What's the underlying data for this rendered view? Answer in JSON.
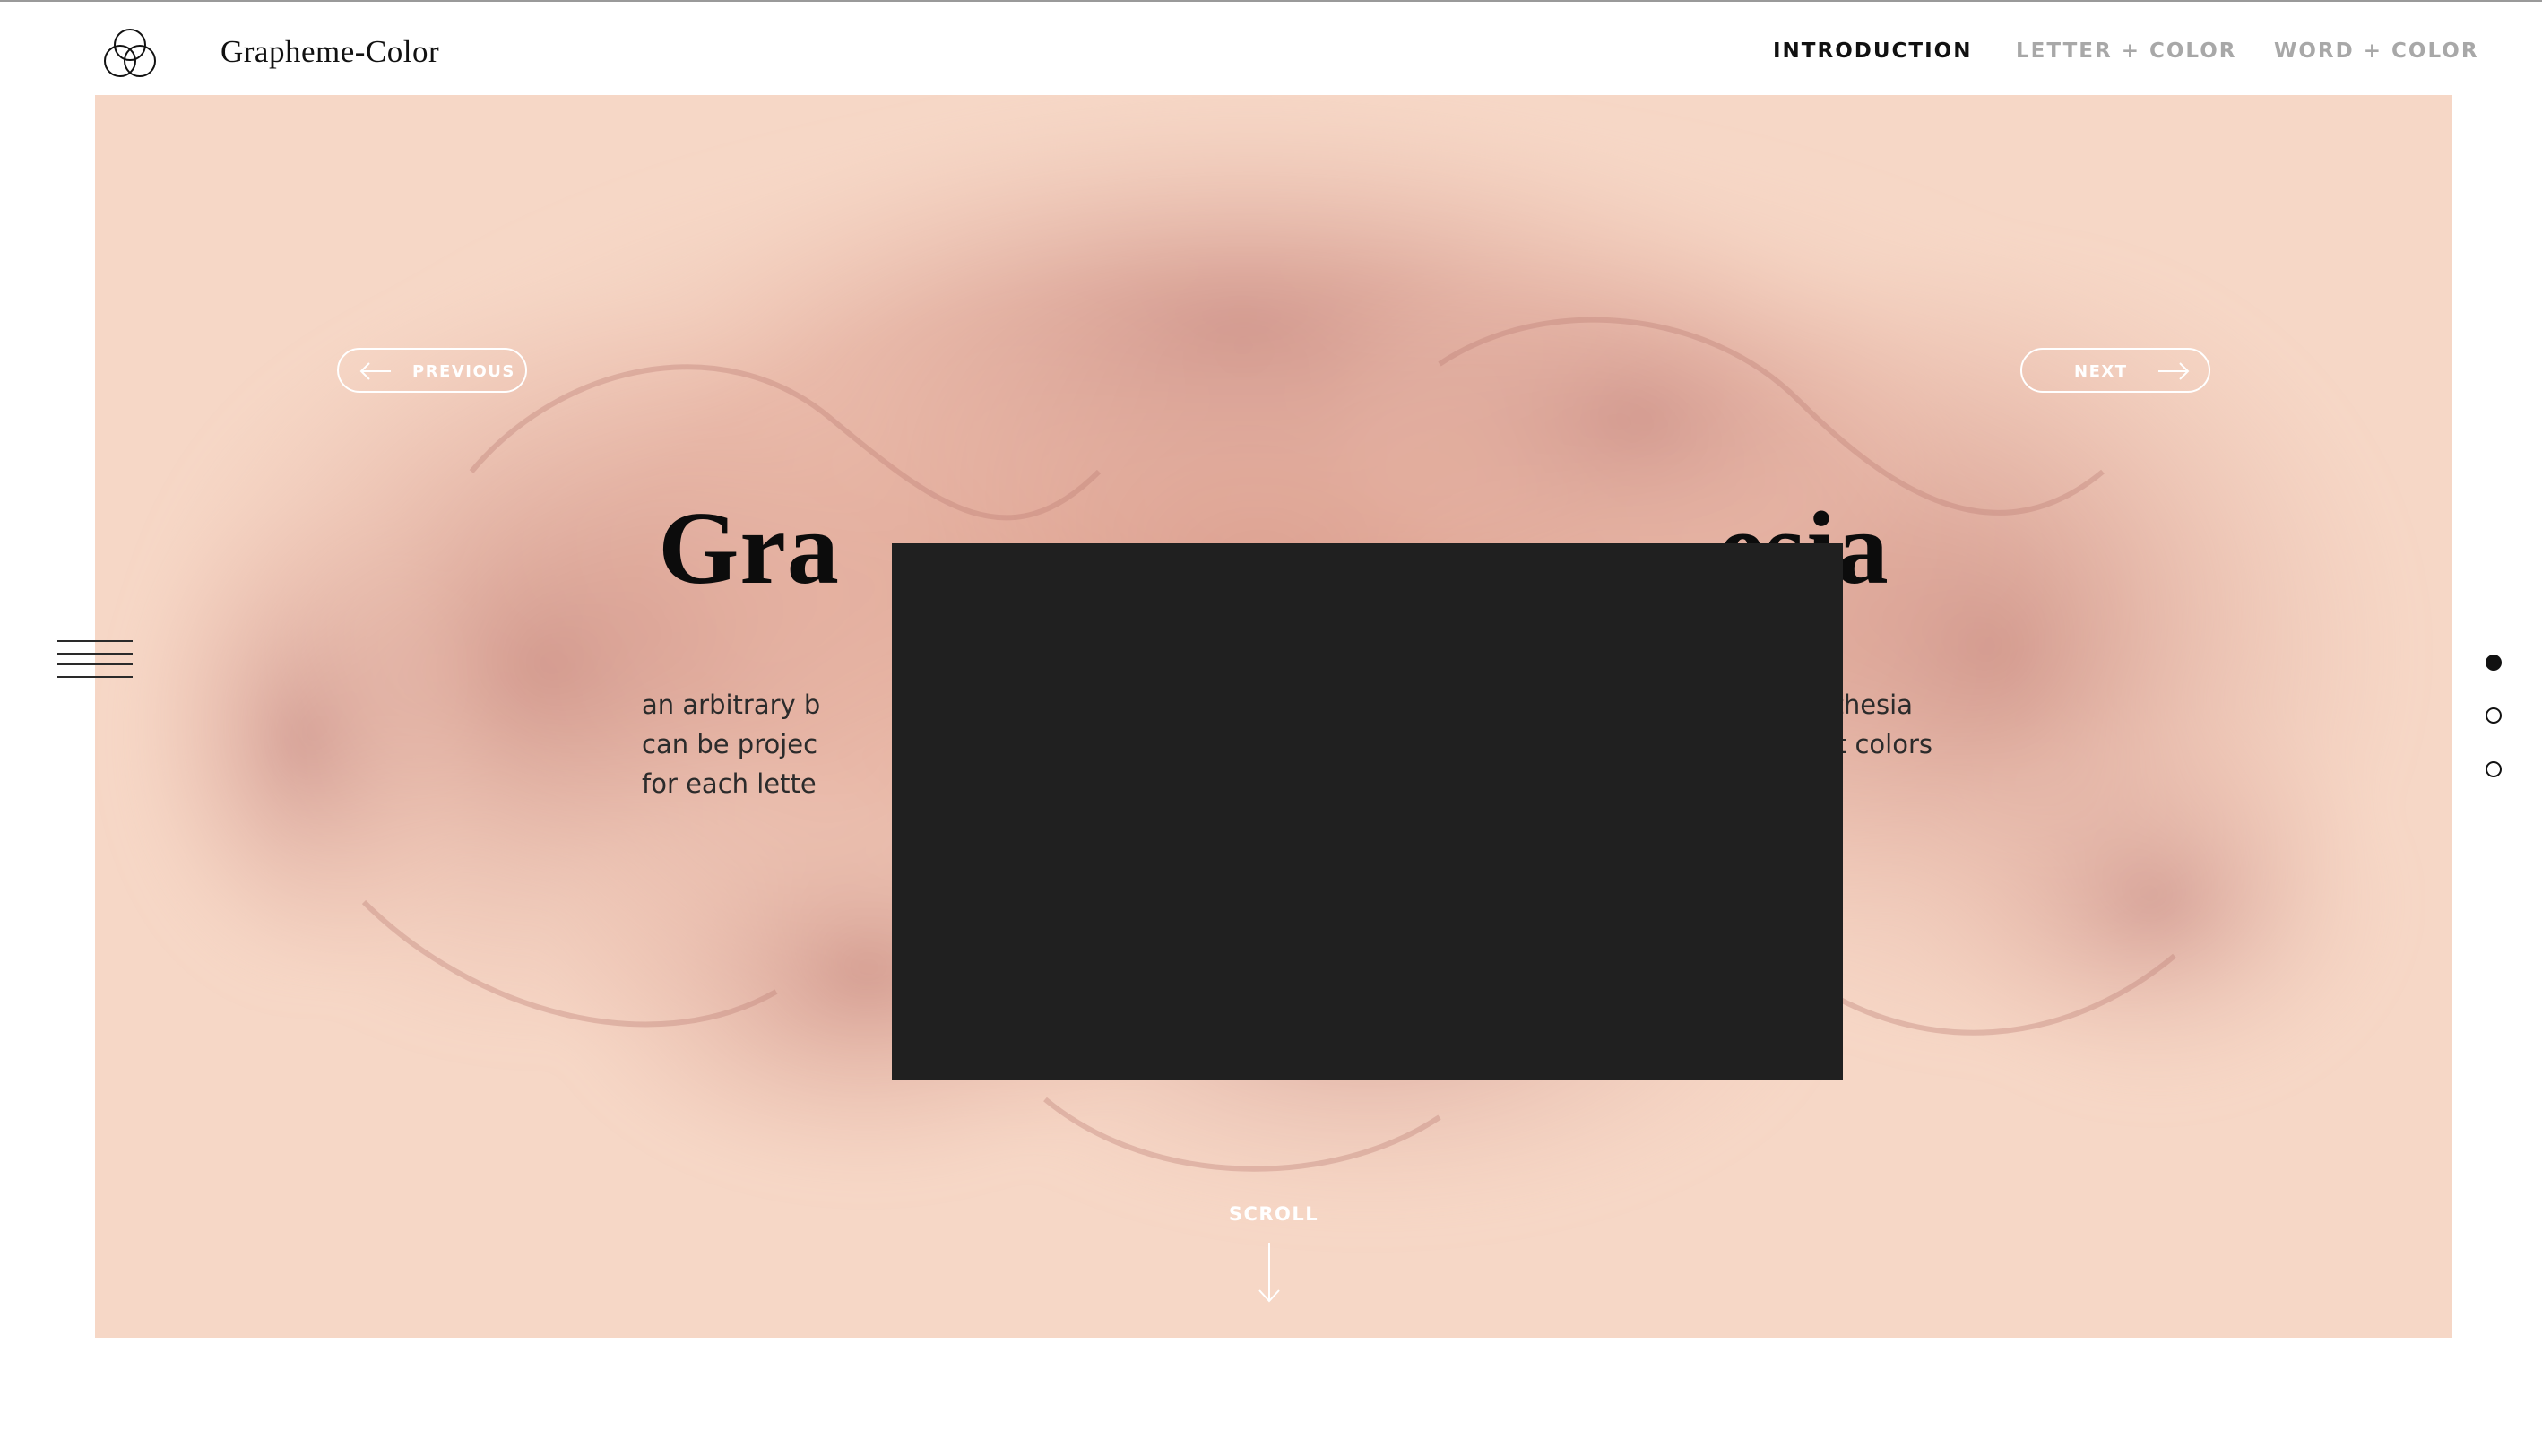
{
  "header": {
    "brand": "Grapheme-Color",
    "logo_icon": "overlapping-circles-logo-icon",
    "nav": [
      {
        "label": "INTRODUCTION",
        "active": true
      },
      {
        "label": "LETTER + COLOR",
        "active": false
      },
      {
        "label": "WORD + COLOR",
        "active": false
      }
    ]
  },
  "hero": {
    "background_color": "#f6d7c6",
    "previous_label": "PREVIOUS",
    "next_label": "NEXT",
    "title_left": "Gra",
    "title_right": "esia",
    "body_lines": [
      {
        "left": "an arbitrary b",
        "right": "r synesthesia"
      },
      {
        "left": "can be projec",
        "right": "different colors"
      },
      {
        "left": "for each lette",
        "right": ""
      }
    ],
    "scroll_label": "SCROLL"
  },
  "side": {
    "menu_icon": "hamburger-menu-icon",
    "slides": [
      {
        "active": true
      },
      {
        "active": false
      },
      {
        "active": false
      }
    ]
  },
  "colors": {
    "accent_text": "#111111",
    "inactive_nav": "#a8a8a8",
    "redaction": "#202020"
  }
}
